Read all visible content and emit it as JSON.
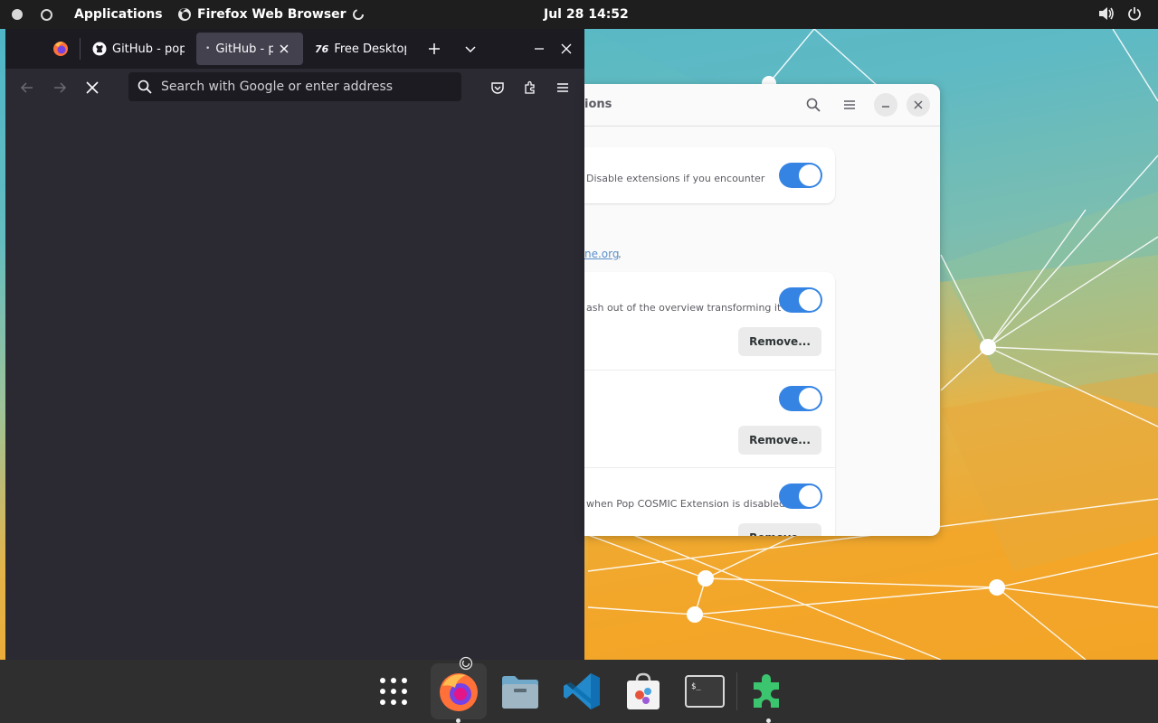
{
  "topbar": {
    "applications_label": "Applications",
    "active_app_label": "Firefox Web Browser",
    "clock": "Jul 28  14:52"
  },
  "firefox": {
    "tabs": [
      {
        "label": "GitHub - pop",
        "icon": "github-icon"
      },
      {
        "label": "GitHub - p",
        "icon": "loading-dot-icon",
        "selected": true
      },
      {
        "label": "Free Desktop",
        "icon": "76-icon"
      }
    ],
    "urlbar_placeholder": "Search with Google or enter address"
  },
  "extensions": {
    "title_fragment": "ions",
    "top_card_desc": "Disable extensions if you encounter",
    "link_text": "ne.org",
    "link_suffix": ".",
    "rows": [
      {
        "desc": "ash out of the overview transforming it i...",
        "remove_label": "Remove..."
      },
      {
        "desc": "",
        "remove_label": "Remove..."
      },
      {
        "desc": "when Pop COSMIC Extension is disabled.",
        "remove_label": "Remove..."
      }
    ]
  },
  "dock": {
    "items": [
      "app-grid-icon",
      "firefox-icon",
      "files-icon",
      "vscode-icon",
      "pop-shop-icon",
      "terminal-icon",
      "extensions-icon"
    ]
  },
  "colors": {
    "accent": "#3584e4",
    "topbar": "#1e1e1e",
    "firefox_bg": "#2b2a33"
  }
}
